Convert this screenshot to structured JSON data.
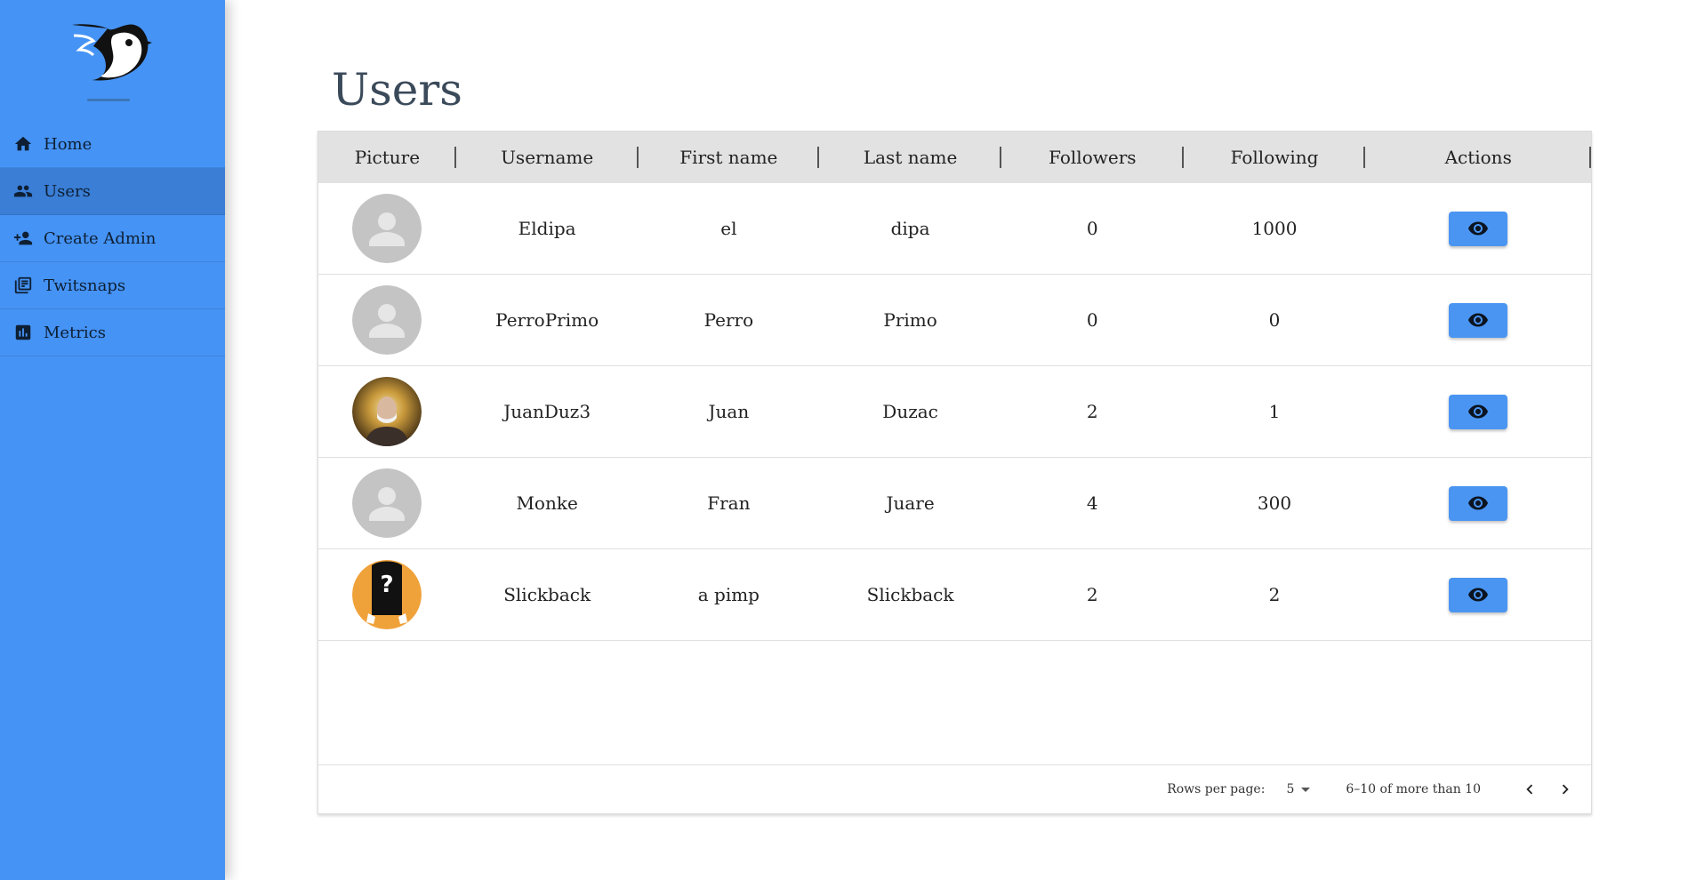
{
  "sidebar": {
    "logo_icon": "bird-logo-icon",
    "items": [
      {
        "label": "Home",
        "icon": "home-icon"
      },
      {
        "label": "Users",
        "icon": "users-icon",
        "active": true
      },
      {
        "label": "Create Admin",
        "icon": "add-user-icon"
      },
      {
        "label": "Twitsnaps",
        "icon": "twitsnaps-icon"
      },
      {
        "label": "Metrics",
        "icon": "bar-chart-icon"
      }
    ]
  },
  "page": {
    "title": "Users"
  },
  "table": {
    "columns": [
      "Picture",
      "Username",
      "First name",
      "Last name",
      "Followers",
      "Following",
      "Actions"
    ],
    "rows": [
      {
        "picture": "default-avatar",
        "username": "Eldipa",
        "first_name": "el",
        "last_name": "dipa",
        "followers": "0",
        "following": "1000"
      },
      {
        "picture": "default-avatar",
        "username": "PerroPrimo",
        "first_name": "Perro",
        "last_name": "Primo",
        "followers": "0",
        "following": "0"
      },
      {
        "picture": "photo-avatar",
        "username": "JuanDuz3",
        "first_name": "Juan",
        "last_name": "Duzac",
        "followers": "2",
        "following": "1"
      },
      {
        "picture": "default-avatar",
        "username": "Monke",
        "first_name": "Fran",
        "last_name": "Juare",
        "followers": "4",
        "following": "300"
      },
      {
        "picture": "mystery-avatar",
        "username": "Slickback",
        "first_name": "a pimp",
        "last_name": "Slickback",
        "followers": "2",
        "following": "2"
      }
    ],
    "action_icon": "eye-icon"
  },
  "pagination": {
    "rows_per_page_label": "Rows per page:",
    "rows_per_page_value": "5",
    "range_text": "6–10 of more than 10"
  },
  "colors": {
    "sidebar": "#4593f5",
    "sidebar_active": "#3a7ed6",
    "action_button": "#4a95f2",
    "header_bg": "#e2e2e2"
  }
}
